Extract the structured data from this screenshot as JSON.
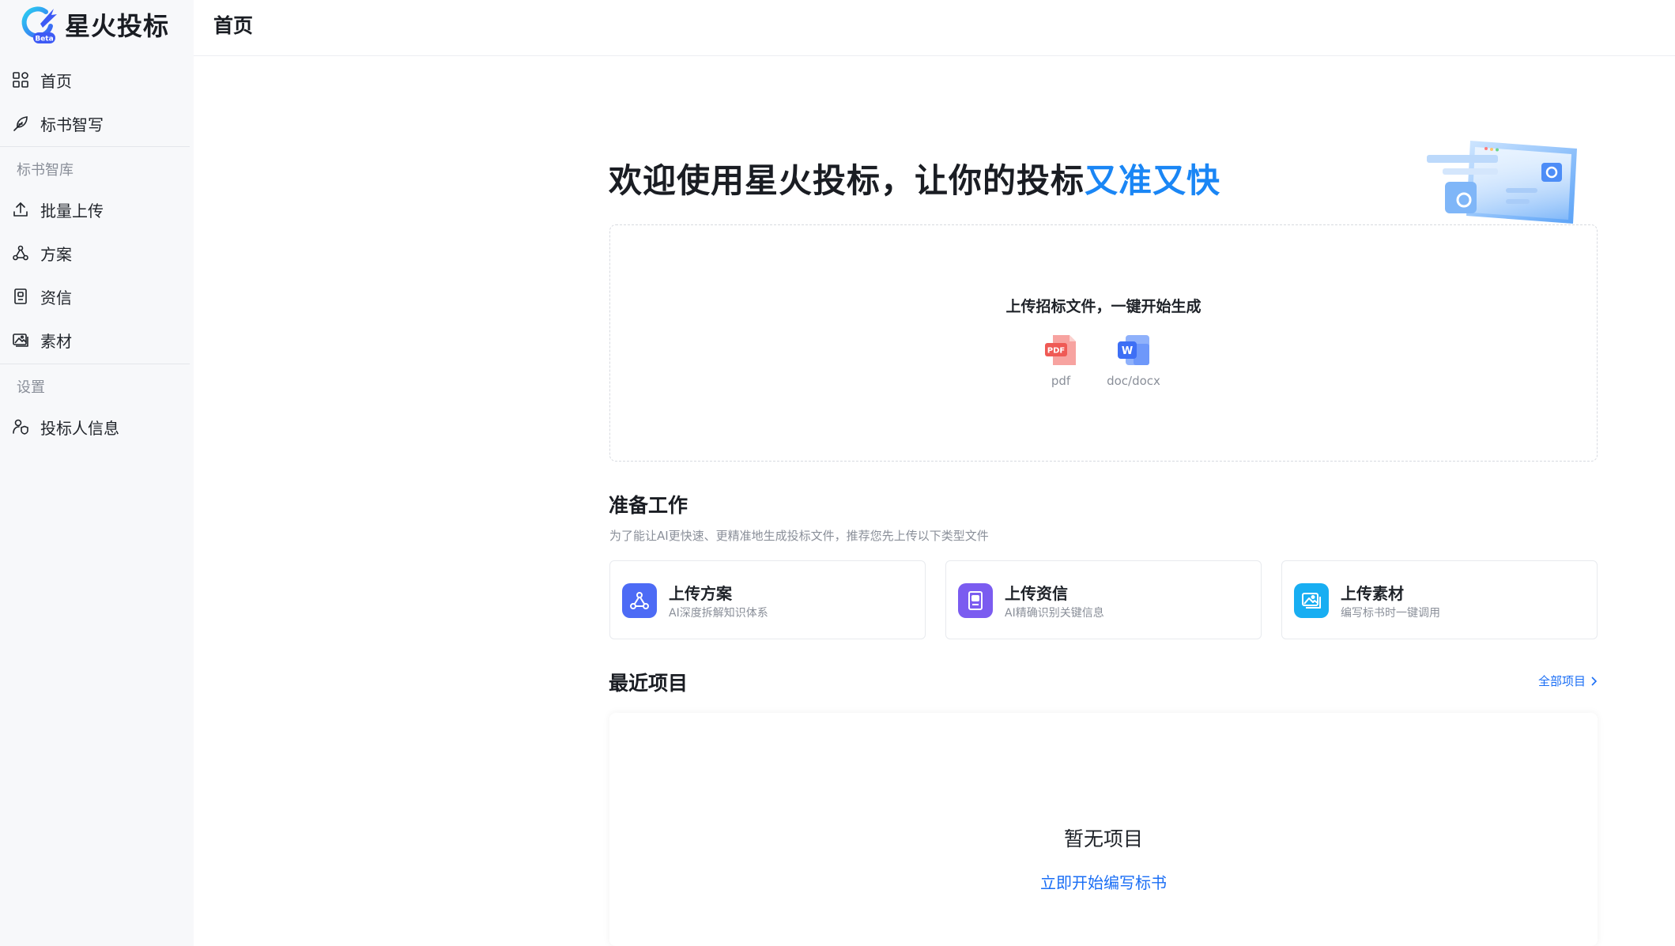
{
  "brand": {
    "name": "星火投标",
    "badge": "Beta"
  },
  "header": {
    "title": "首页"
  },
  "sidebar": {
    "items": [
      {
        "label": "首页",
        "icon": "grid-icon"
      },
      {
        "label": "标书智写",
        "icon": "feather-icon"
      }
    ],
    "groups": [
      {
        "title": "标书智库",
        "items": [
          {
            "label": "批量上传",
            "icon": "upload-icon"
          },
          {
            "label": "方案",
            "icon": "nodes-icon"
          },
          {
            "label": "资信",
            "icon": "document-icon"
          },
          {
            "label": "素材",
            "icon": "image-icon"
          }
        ]
      },
      {
        "title": "设置",
        "items": [
          {
            "label": "投标人信息",
            "icon": "user-shield-icon"
          }
        ]
      }
    ]
  },
  "hero": {
    "title_prefix": "欢迎使用星火投标，让你的投标",
    "title_accent": "又准又快"
  },
  "upload": {
    "prompt": "上传招标文件，一键开始生成",
    "types": [
      {
        "label": "pdf",
        "icon": "pdf-icon",
        "badge": "PDF"
      },
      {
        "label": "doc/docx",
        "icon": "word-icon",
        "badge": "W"
      }
    ]
  },
  "prep": {
    "title": "准备工作",
    "subtitle": "为了能让AI更快速、更精准地生成投标文件，推荐您先上传以下类型文件",
    "cards": [
      {
        "title": "上传方案",
        "desc": "AI深度拆解知识体系",
        "icon": "nodes-icon",
        "color": "#4d6bf5"
      },
      {
        "title": "上传资信",
        "desc": "AI精确识别关键信息",
        "icon": "document-icon",
        "color": "#7b5cf0"
      },
      {
        "title": "上传素材",
        "desc": "编写标书时一键调用",
        "icon": "image-icon",
        "color": "#18aef2"
      }
    ]
  },
  "recent": {
    "title": "最近项目",
    "all_link": "全部项目",
    "empty_text": "暂无项目",
    "empty_action": "立即开始编写标书"
  },
  "colors": {
    "accent": "#1a86f5",
    "link": "#1a6ef5",
    "sidebar_bg": "#f7f8fa"
  }
}
